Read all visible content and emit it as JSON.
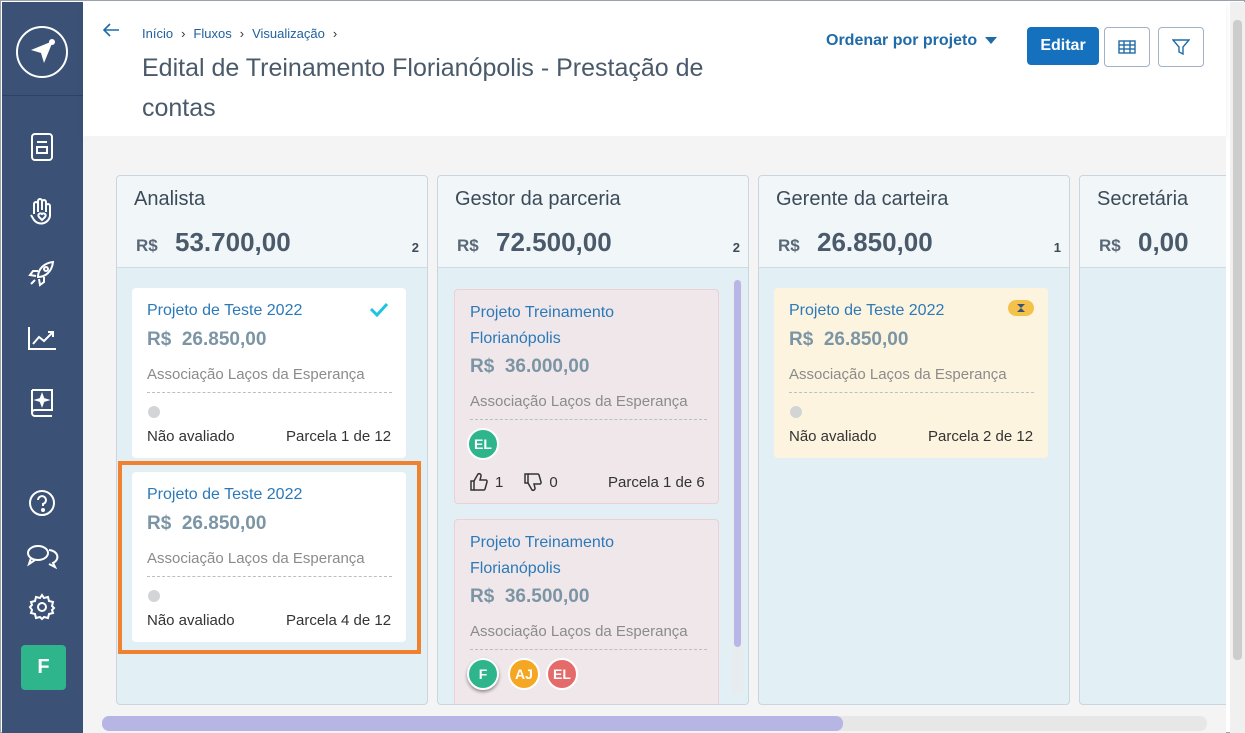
{
  "breadcrumb": {
    "items": [
      "Início",
      "Fluxos",
      "Visualização"
    ]
  },
  "page": {
    "title": "Edital de Treinamento Florianópolis - Prestação de contas"
  },
  "toolbar": {
    "sort_label": "Ordenar por projeto",
    "edit_label": "Editar"
  },
  "sidebar": {
    "icons": [
      "logo-icon",
      "document-icon",
      "heart-hand-icon",
      "rocket-icon",
      "trend-chart-icon",
      "book-sparkle-icon",
      "help-icon",
      "chat-icon",
      "gear-icon"
    ],
    "user_initial": "F"
  },
  "columns": [
    {
      "title": "Analista",
      "currency": "R$",
      "total": "53.700,00",
      "count": "2",
      "cards": [
        {
          "title": "Projeto de Teste 2022",
          "currency": "R$",
          "value": "26.850,00",
          "org": "Associação Laços da Esperança",
          "status": "Não avaliado",
          "parcela": "Parcela 1 de 12",
          "badge": "check-icon"
        },
        {
          "title": "Projeto de Teste 2022",
          "currency": "R$",
          "value": "26.850,00",
          "org": "Associação Laços da Esperança",
          "status": "Não avaliado",
          "parcela": "Parcela 4 de 12"
        }
      ]
    },
    {
      "title": "Gestor da parceria",
      "currency": "R$",
      "total": "72.500,00",
      "count": "2",
      "cards": [
        {
          "title_line1": "Projeto Treinamento",
          "title_line2": "Florianópolis",
          "currency": "R$",
          "value": "36.000,00",
          "org": "Associação Laços da Esperança",
          "avatars": [
            "EL"
          ],
          "likes": "1",
          "dislikes": "0",
          "parcela": "Parcela 1 de 6"
        },
        {
          "title_line1": "Projeto Treinamento",
          "title_line2": "Florianópolis",
          "currency": "R$",
          "value": "36.500,00",
          "org": "Associação Laços da Esperança",
          "avatars": [
            "F",
            "AJ",
            "EL"
          ]
        }
      ]
    },
    {
      "title": "Gerente da carteira",
      "currency": "R$",
      "total": "26.850,00",
      "count": "1",
      "cards": [
        {
          "title": "Projeto de Teste 2022",
          "currency": "R$",
          "value": "26.850,00",
          "org": "Associação Laços da Esperança",
          "status": "Não avaliado",
          "parcela": "Parcela 2 de 12",
          "badge": "hourglass-icon"
        }
      ]
    },
    {
      "title": "Secretária",
      "currency": "R$",
      "total": "0,00"
    }
  ],
  "colors": {
    "sidebar": "#3b5276",
    "primary": "#1571bd",
    "highlight": "#f0812e",
    "accent_check": "#1fc4e0"
  }
}
